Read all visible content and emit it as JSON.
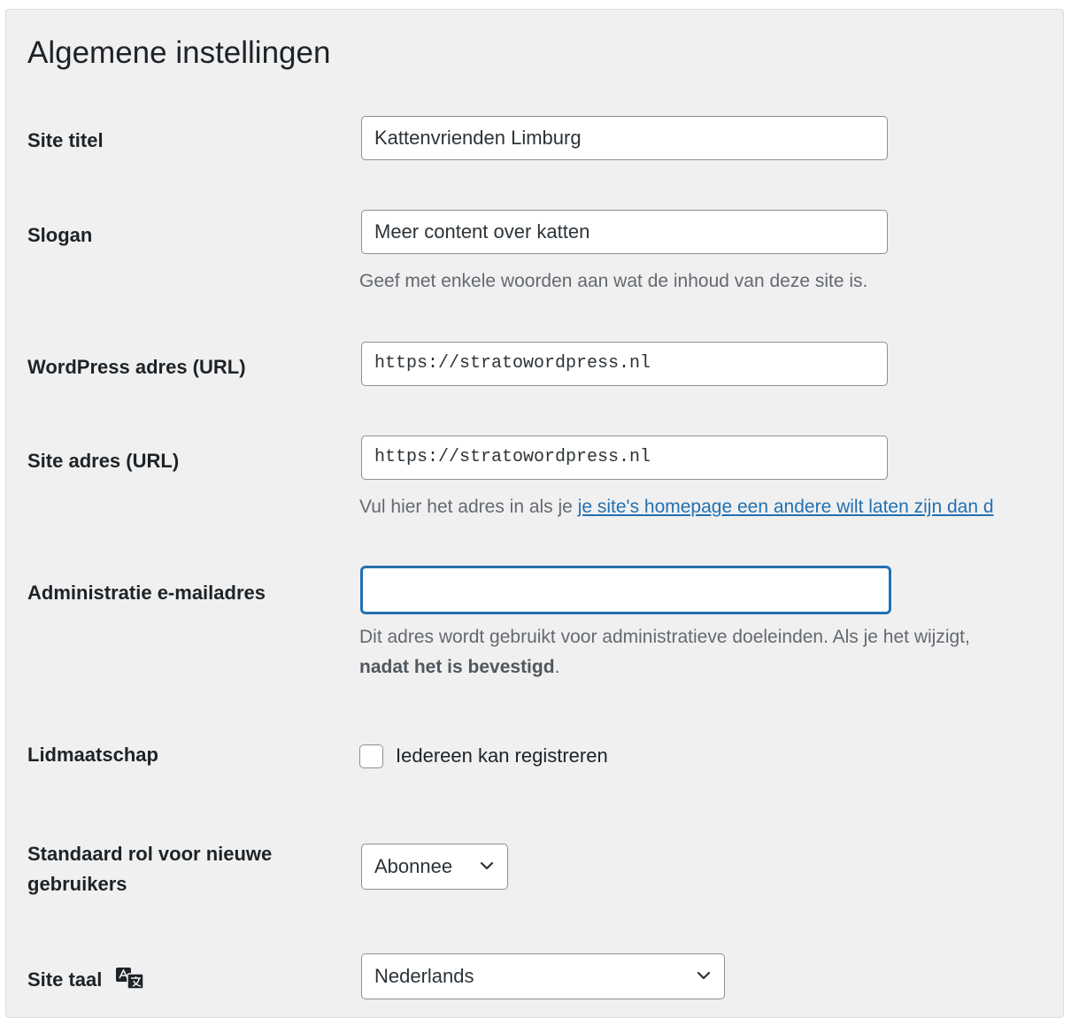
{
  "page": {
    "title": "Algemene instellingen"
  },
  "fields": {
    "site_title": {
      "label": "Site titel",
      "value": "Kattenvrienden Limburg"
    },
    "slogan": {
      "label": "Slogan",
      "value": "Meer content over katten",
      "description": "Geef met enkele woorden aan wat de inhoud van deze site is."
    },
    "wp_url": {
      "label": "WordPress adres (URL)",
      "value": "https://stratowordpress.nl"
    },
    "site_url": {
      "label": "Site adres (URL)",
      "value": "https://stratowordpress.nl",
      "description_prefix": "Vul hier het adres in als je ",
      "description_link": "je site's homepage een andere wilt laten zijn dan d"
    },
    "admin_email": {
      "label": "Administratie e-mailadres",
      "value": "",
      "description_line1": "Dit adres wordt gebruikt voor administratieve doeleinden. Als je het wijzigt,",
      "description_bold": "nadat het is bevestigd",
      "description_end": "."
    },
    "membership": {
      "label": "Lidmaatschap",
      "checkbox_label": "Iedereen kan registreren",
      "checked": false
    },
    "default_role": {
      "label_line1": "Standaard rol voor nieuwe",
      "label_line2": "gebruikers",
      "selected": "Abonnee"
    },
    "site_language": {
      "label": "Site taal",
      "selected": "Nederlands"
    }
  },
  "colors": {
    "accent": "#2271b1",
    "background": "#f0f0f1",
    "text": "#1d2327",
    "muted": "#646970"
  },
  "icons": {
    "translation": "translation-icon",
    "select": "chevron-down-icon"
  }
}
